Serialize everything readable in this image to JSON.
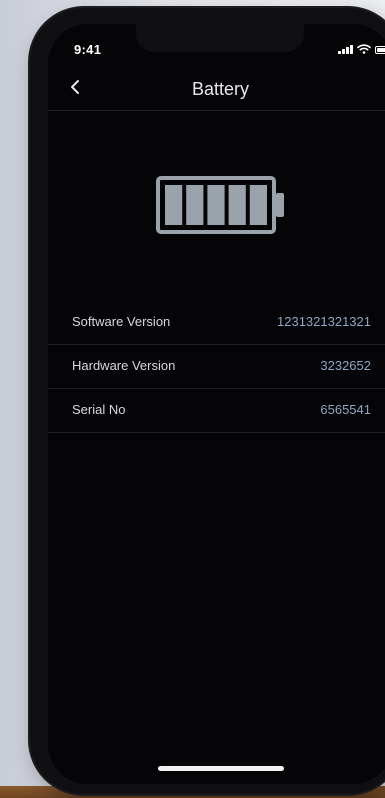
{
  "status_bar": {
    "time": "9:41"
  },
  "nav": {
    "title": "Battery",
    "back_icon": "chevron-left-icon"
  },
  "battery": {
    "level_percent": 100,
    "segments_filled": 5,
    "segments_total": 5,
    "color": "#9aa2ac"
  },
  "info_rows": [
    {
      "label": "Software Version",
      "value": "1231321321321"
    },
    {
      "label": "Hardware Version",
      "value": "3232652"
    },
    {
      "label": "Serial No",
      "value": "6565541"
    }
  ],
  "colors": {
    "background": "#050507",
    "value_text": "#8fa6c4",
    "label_text": "#d6d8de",
    "divider": "#1c1f27"
  }
}
